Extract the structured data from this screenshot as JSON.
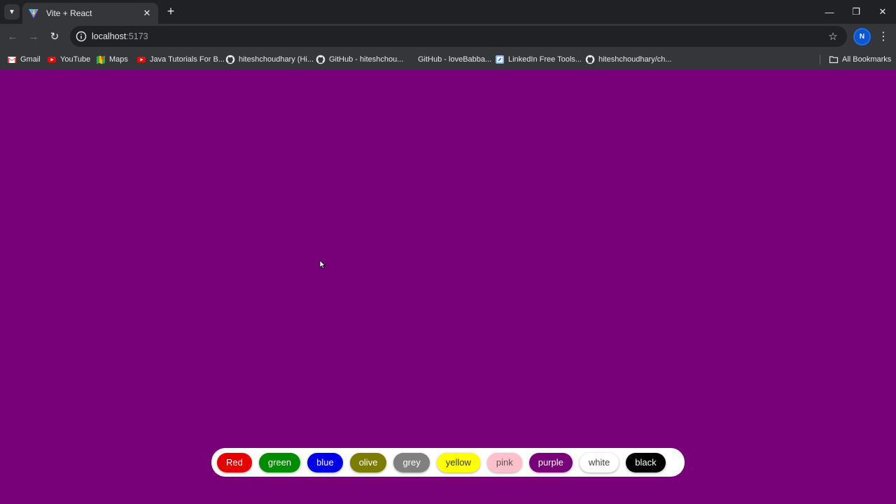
{
  "browser": {
    "tab": {
      "title": "Vite + React",
      "close_glyph": "✕"
    },
    "new_tab_glyph": "+",
    "window_controls": {
      "minimize": "—",
      "restore": "❐",
      "close": "✕"
    },
    "nav": {
      "back": "←",
      "forward": "→",
      "reload": "↻"
    },
    "address": {
      "host": "localhost",
      "port": ":5173"
    },
    "bookmark_star": "☆",
    "profile_initial": "N",
    "menu_glyph": "⋮",
    "bookmarks": [
      {
        "label": "Gmail",
        "icon": "gmail-icon"
      },
      {
        "label": "YouTube",
        "icon": "youtube-icon"
      },
      {
        "label": "Maps",
        "icon": "maps-icon"
      },
      {
        "label": "Java Tutorials For B...",
        "icon": "youtube-icon"
      },
      {
        "label": "hiteshchoudhary (Hi...",
        "icon": "github-icon"
      },
      {
        "label": "GitHub - hiteshchou...",
        "icon": "github-icon"
      },
      {
        "label": "GitHub - loveBabba...",
        "icon": "github-icon"
      },
      {
        "label": "LinkedIn Free Tools...",
        "icon": "linkedin-tools-icon"
      },
      {
        "label": "hiteshchoudhary/ch...",
        "icon": "github-icon"
      }
    ],
    "all_bookmarks": "All Bookmarks"
  },
  "page": {
    "background": "#780078",
    "buttons": [
      {
        "label": "Red",
        "bg": "#e60000",
        "fg": "#ffffff"
      },
      {
        "label": "green",
        "bg": "#008c00",
        "fg": "#ffffff"
      },
      {
        "label": "blue",
        "bg": "#0000e6",
        "fg": "#ffffff"
      },
      {
        "label": "olive",
        "bg": "#7c7c00",
        "fg": "#ffffff"
      },
      {
        "label": "grey",
        "bg": "#808080",
        "fg": "#ffffff"
      },
      {
        "label": "yellow",
        "bg": "#ffff00",
        "fg": "#333333"
      },
      {
        "label": "pink",
        "bg": "#ffc0cb",
        "fg": "#555555"
      },
      {
        "label": "purple",
        "bg": "#780078",
        "fg": "#ffffff"
      },
      {
        "label": "white",
        "bg": "#ffffff",
        "fg": "#444444"
      },
      {
        "label": "black",
        "bg": "#000000",
        "fg": "#ffffff"
      }
    ]
  }
}
